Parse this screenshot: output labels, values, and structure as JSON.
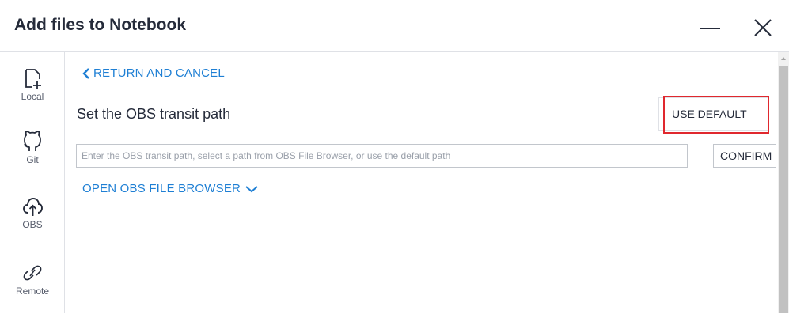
{
  "window": {
    "title": "Add files to Notebook",
    "minimize_icon": "minimize-icon",
    "close_icon": "close-icon"
  },
  "sidebar": {
    "items": [
      {
        "label": "Local",
        "icon": "file-add-icon"
      },
      {
        "label": "Git",
        "icon": "github-icon"
      },
      {
        "label": "OBS",
        "icon": "cloud-upload-icon"
      },
      {
        "label": "Remote",
        "icon": "link-icon"
      }
    ]
  },
  "main": {
    "return_label": "RETURN AND CANCEL",
    "section_title": "Set the OBS transit path",
    "use_default_label": "USE DEFAULT",
    "path_placeholder": "Enter the OBS transit path, select a path from OBS File Browser, or use the default path",
    "path_value": "",
    "confirm_label": "CONFIRM",
    "open_browser_label": "OPEN OBS FILE BROWSER"
  },
  "colors": {
    "link": "#1e7fd4",
    "highlight": "#e0282e",
    "text": "#252b3a",
    "border": "#dfe1e6"
  }
}
